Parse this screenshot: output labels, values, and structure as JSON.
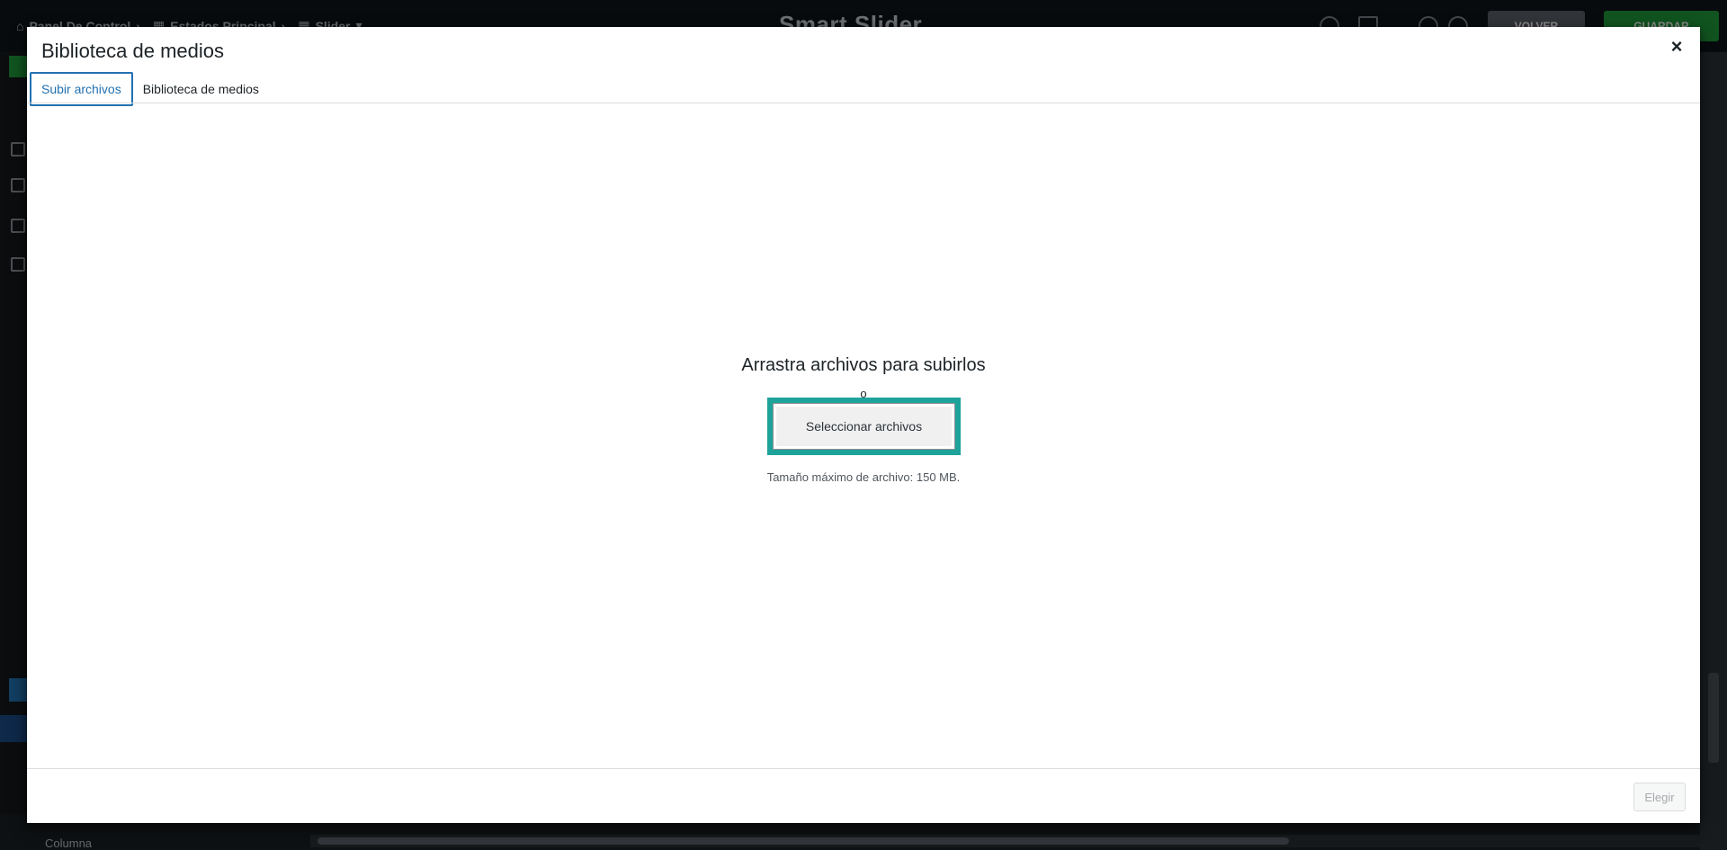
{
  "background": {
    "breadcrumbs": [
      "Panel De Control",
      "Estados Principal",
      "Slider"
    ],
    "logo_text": "Smart Slider",
    "volver_label": "VOLVER",
    "guardar_label": "GUARDAR",
    "layer_label": "Columna"
  },
  "modal": {
    "title": "Biblioteca de medios",
    "close_label": "×",
    "tabs": [
      {
        "label": "Subir archivos",
        "active": true
      },
      {
        "label": "Biblioteca de medios",
        "active": false
      }
    ],
    "uploader": {
      "instructions": "Arrastra archivos para subirlos",
      "or_text": "o",
      "select_button_label": "Seleccionar archivos",
      "max_size_text": "Tamaño máximo de archivo: 150 MB."
    },
    "footer": {
      "choose_button_label": "Elegir"
    }
  },
  "colors": {
    "accent": "#2271b1",
    "highlight": "#1ea39a",
    "save_green": "#1f9a3b"
  }
}
